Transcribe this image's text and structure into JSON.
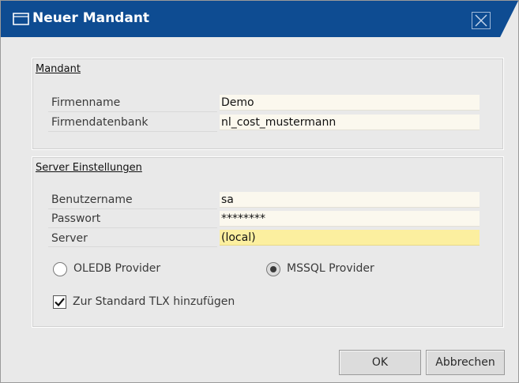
{
  "window": {
    "title": "Neuer Mandant",
    "icon": "window-icon",
    "close_icon": "close-icon"
  },
  "mandant_group": {
    "title": "Mandant",
    "fields": [
      {
        "label": "Firmenname",
        "value": "Demo"
      },
      {
        "label": "Firmendatenbank",
        "value": "nl_cost_mustermann"
      }
    ]
  },
  "server_group": {
    "title": "Server Einstellungen",
    "fields": [
      {
        "label": "Benutzername",
        "value": "sa"
      },
      {
        "label": "Passwort",
        "value": "********"
      },
      {
        "label": "Server",
        "value": "(local)"
      }
    ],
    "providers": [
      {
        "label": "OLEDB Provider",
        "selected": false
      },
      {
        "label": "MSSQL Provider",
        "selected": true
      }
    ],
    "checkbox": {
      "label": "Zur Standard TLX hinzufügen",
      "checked": true
    }
  },
  "buttons": {
    "ok": "OK",
    "cancel": "Abbrechen"
  },
  "colors": {
    "titlebar": "#0e4c92",
    "field_bg": "#fbf8ee",
    "active_field_bg": "#fcef9f"
  }
}
